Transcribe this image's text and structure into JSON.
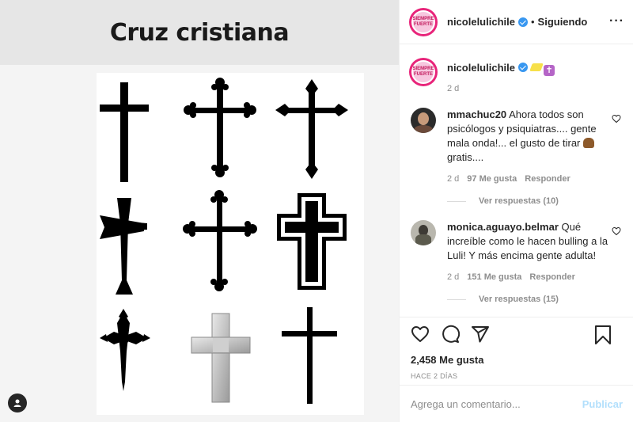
{
  "post_image": {
    "title": "Cruz cristiana",
    "user_tag_icon": "user-tag-icon"
  },
  "header": {
    "username": "nicolelulichile",
    "verified_icon": "verified-badge-icon",
    "separator": "•",
    "follow_status": "Siguiendo",
    "more_icon": "more-options-icon",
    "more_label": "···",
    "avatar_text": "SIEMPRE FUERTE"
  },
  "caption": {
    "username": "nicolelulichile",
    "emojis": [
      "sparkles-emoji",
      "latin-cross-emoji"
    ],
    "cross_glyph": "✝",
    "time": "2 d"
  },
  "comments": [
    {
      "username": "mmachuc20",
      "text": "Ahora todos son psicólogos y psiquiatras.... gente mala onda!... el gusto de tirar",
      "emoji": "poop-emoji",
      "text_after": "gratis....",
      "time": "2 d",
      "likes": "97 Me gusta",
      "reply": "Responder",
      "view_replies": "Ver respuestas (10)"
    },
    {
      "username": "monica.aguayo.belmar",
      "text": "Qué increíble como le hacen bulling a la Luli! Y más encima gente adulta!",
      "time": "2 d",
      "likes": "151 Me gusta",
      "reply": "Responder",
      "view_replies": "Ver respuestas (15)"
    }
  ],
  "actions": {
    "icons": [
      "heart-icon",
      "comment-icon",
      "share-icon",
      "bookmark-icon"
    ],
    "likes": "2,458 Me gusta",
    "time_ago": "HACE 2 DÍAS"
  },
  "add_comment": {
    "placeholder": "Agrega un comentario...",
    "publish": "Publicar"
  },
  "colors": {
    "verified": "#3897f0",
    "publish_disabled": "#b2dffc",
    "secondary_text": "#8e8e8e",
    "border": "#efefef"
  }
}
